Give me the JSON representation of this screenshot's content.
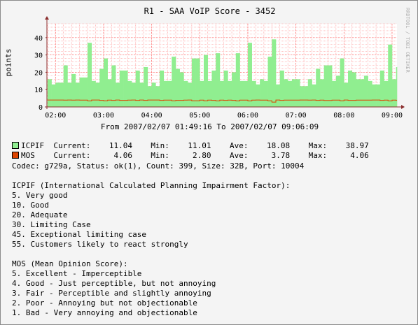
{
  "title": "R1 - SAA VoIP Score - 3452",
  "watermark": "RRDTOOL / TOBI OETIKER",
  "range_text": "From 2007/02/07 01:49:16 To 2007/02/07 09:06:09",
  "legend": [
    {
      "name": "ICPIF",
      "color": "#dd4400",
      "swatch_color": "#90ee90",
      "line": "ICPIF  Current:    11.04    Min:    11.01    Ave:    18.08    Max:    38.97"
    },
    {
      "name": "MOS",
      "color": "#dd4400",
      "swatch_color": "#dd4400",
      "line": "MOS    Current:     4.06    Min:     2.80    Ave:     3.78    Max:     4.06"
    }
  ],
  "info_line": "Codec: g729a, Status: ok(1), Count: 399, Size: 32B, Port: 10004",
  "icpif_text": [
    "ICPIF (International Calculated Planning Impairment Factor):",
    "5. Very good",
    "10. Good",
    "20. Adequate",
    "30. Limiting Case",
    "45. Exceptional limiting case",
    "55. Customers likely to react strongly"
  ],
  "mos_text": [
    "MOS (Mean Opinion Score):",
    "5. Excellent - Imperceptible",
    "4. Good - Just perceptible, but not annoying",
    "3. Fair - Perceptible and slightly annoying",
    "2. Poor - Annoying but not objectionable",
    "1. Bad - Very annoying and objectionable"
  ],
  "colors": {
    "icpif_fill": "#90ee90",
    "mos_line": "#dd4400",
    "grid": "#ff9c9c",
    "axis": "#8b2e2e",
    "plot_bg": "#ffffff"
  },
  "chart_data": {
    "type": "area",
    "ylabel": "points",
    "ylim": [
      0,
      48
    ],
    "yticks": [
      0,
      10,
      20,
      30,
      40
    ],
    "xlim": [
      "01:49:16",
      "09:06:09"
    ],
    "x_ticks": [
      "02:00",
      "03:00",
      "04:00",
      "05:00",
      "06:00",
      "07:00",
      "08:00",
      "09:00"
    ],
    "grid": true,
    "x": [
      "01:50",
      "01:55",
      "02:00",
      "02:05",
      "02:10",
      "02:15",
      "02:20",
      "02:25",
      "02:30",
      "02:35",
      "02:40",
      "02:45",
      "02:50",
      "02:55",
      "03:00",
      "03:05",
      "03:10",
      "03:15",
      "03:20",
      "03:25",
      "03:30",
      "03:35",
      "03:40",
      "03:45",
      "03:50",
      "03:55",
      "04:00",
      "04:05",
      "04:10",
      "04:15",
      "04:20",
      "04:25",
      "04:30",
      "04:35",
      "04:40",
      "04:45",
      "04:50",
      "04:55",
      "05:00",
      "05:05",
      "05:10",
      "05:15",
      "05:20",
      "05:25",
      "05:30",
      "05:35",
      "05:40",
      "05:45",
      "05:50",
      "05:55",
      "06:00",
      "06:05",
      "06:10",
      "06:15",
      "06:20",
      "06:25",
      "06:30",
      "06:35",
      "06:40",
      "06:45",
      "06:50",
      "06:55",
      "07:00",
      "07:05",
      "07:10",
      "07:15",
      "07:20",
      "07:25",
      "07:30",
      "07:35",
      "07:40",
      "07:45",
      "07:50",
      "07:55",
      "08:00",
      "08:05",
      "08:10",
      "08:15",
      "08:20",
      "08:25",
      "08:30",
      "08:35",
      "08:40",
      "08:45",
      "08:50",
      "08:55",
      "09:00",
      "09:05"
    ],
    "series": [
      {
        "name": "ICPIF",
        "values": [
          16,
          13,
          14,
          14,
          24,
          14,
          19,
          14,
          17,
          17,
          37,
          15,
          14,
          22,
          28,
          16,
          24,
          14,
          21,
          21,
          15,
          14,
          21,
          14,
          23,
          12,
          14,
          12,
          21,
          15,
          15,
          29,
          22,
          20,
          15,
          14,
          28,
          28,
          15,
          30,
          15,
          21,
          31,
          15,
          21,
          15,
          20,
          31,
          15,
          15,
          37,
          15,
          13,
          16,
          15,
          29,
          39,
          13,
          21,
          16,
          15,
          16,
          16,
          12,
          12,
          16,
          13,
          22,
          16,
          24,
          24,
          15,
          18,
          28,
          14,
          21,
          20,
          16,
          16,
          18,
          15,
          13,
          13,
          21,
          15,
          36,
          16,
          23,
          23
        ]
      },
      {
        "name": "MOS",
        "values": [
          4.0,
          4.0,
          4.0,
          4.0,
          3.9,
          4.0,
          3.9,
          4.0,
          3.9,
          3.9,
          3.5,
          4.0,
          4.0,
          3.8,
          3.6,
          3.9,
          3.8,
          4.0,
          3.8,
          3.8,
          3.9,
          4.0,
          3.8,
          4.0,
          3.8,
          4.0,
          4.0,
          4.0,
          3.8,
          3.9,
          3.9,
          3.6,
          3.8,
          3.8,
          3.9,
          4.0,
          3.6,
          3.6,
          3.9,
          3.6,
          3.9,
          3.8,
          3.5,
          3.9,
          3.8,
          3.9,
          3.8,
          3.5,
          3.9,
          3.9,
          3.5,
          3.9,
          4.0,
          3.9,
          3.9,
          3.6,
          2.8,
          4.0,
          3.8,
          3.9,
          3.9,
          3.9,
          3.9,
          4.0,
          4.0,
          3.9,
          4.0,
          3.8,
          3.9,
          3.7,
          3.7,
          3.9,
          3.9,
          3.6,
          4.0,
          3.8,
          3.8,
          3.9,
          3.9,
          3.9,
          3.9,
          4.0,
          4.0,
          3.8,
          3.9,
          3.5,
          3.9,
          3.8,
          3.8
        ]
      }
    ]
  }
}
